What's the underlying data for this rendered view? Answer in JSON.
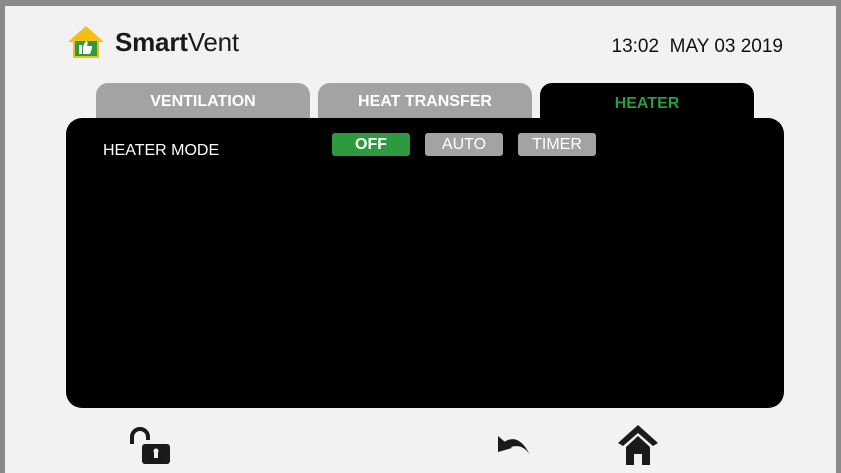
{
  "header": {
    "brand_bold": "Smart",
    "brand_light": "Vent",
    "datetime": "13:02  MAY 03 2019"
  },
  "tabs": [
    {
      "label": "VENTILATION",
      "active": false
    },
    {
      "label": "HEAT TRANSFER",
      "active": false
    },
    {
      "label": "HEATER",
      "active": true
    }
  ],
  "heater": {
    "mode_label": "HEATER MODE",
    "options": [
      {
        "label": "OFF",
        "selected": true
      },
      {
        "label": "AUTO",
        "selected": false
      },
      {
        "label": "TIMER",
        "selected": false
      }
    ]
  },
  "footer": {
    "icons": [
      "unlock-icon",
      "back-icon",
      "home-icon"
    ]
  },
  "colors": {
    "accent_green": "#2e9a3e",
    "inactive_gray": "#a3a3a3",
    "panel_black": "#000000",
    "logo_yellow": "#f2c012"
  }
}
